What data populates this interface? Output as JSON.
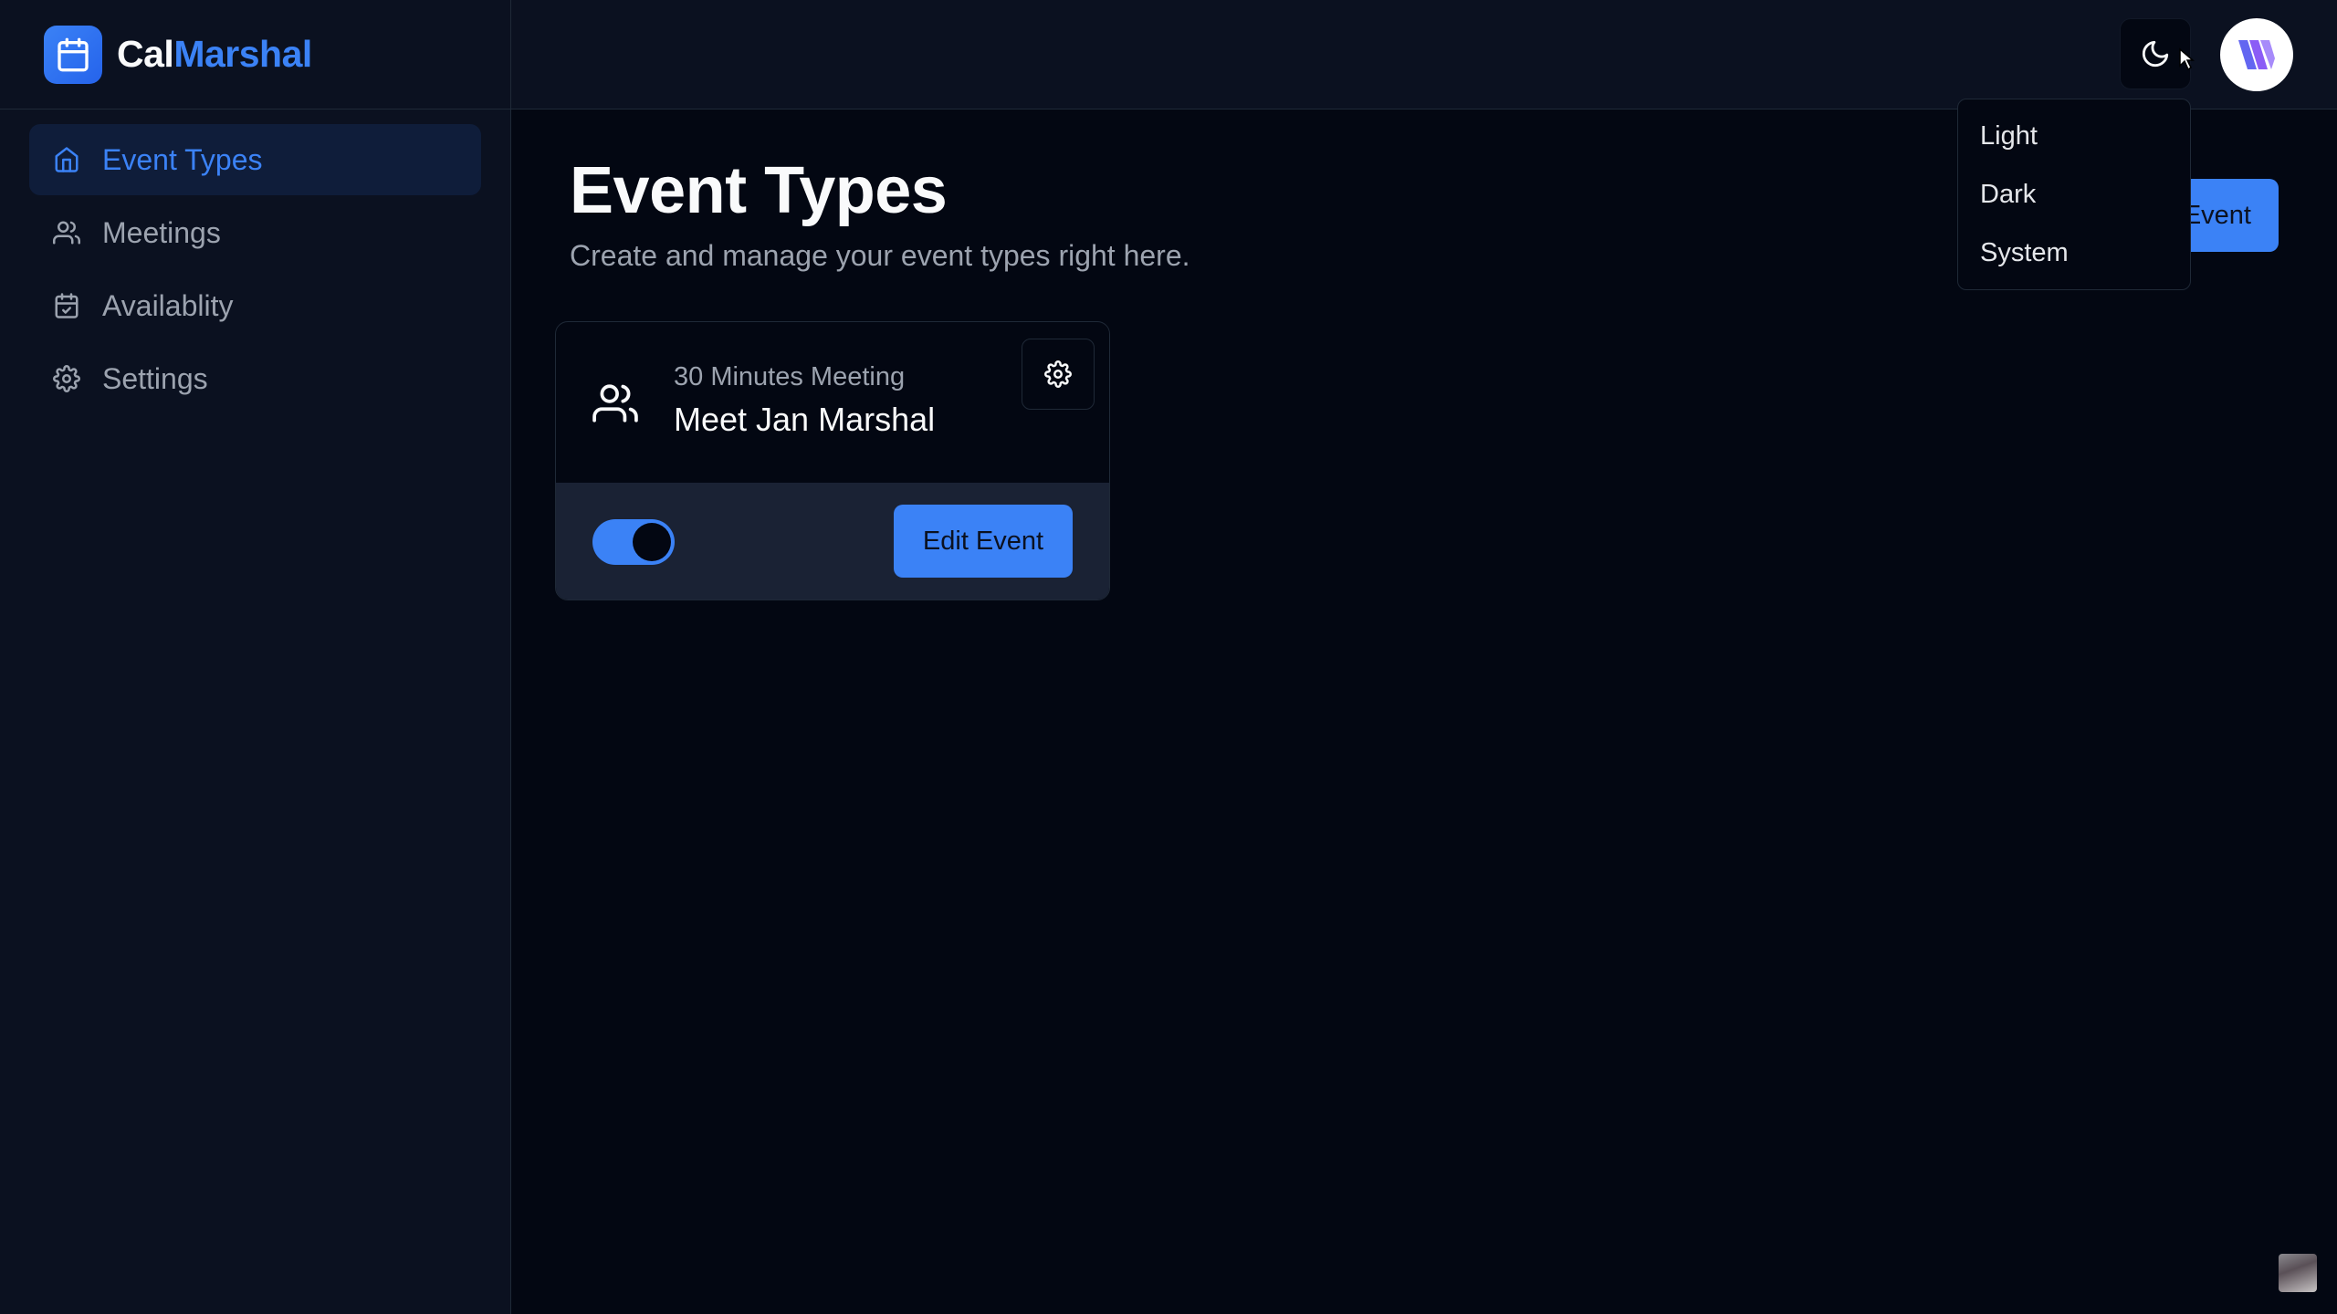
{
  "brand": {
    "name_part1": "Cal",
    "name_part2": "Marshal",
    "logo_icon": "calendar-icon",
    "accent_color": "#3b82f6"
  },
  "sidebar": {
    "items": [
      {
        "label": "Event Types",
        "icon": "home-icon",
        "active": true
      },
      {
        "label": "Meetings",
        "icon": "users-icon",
        "active": false
      },
      {
        "label": "Availablity",
        "icon": "calendar-check-icon",
        "active": false
      },
      {
        "label": "Settings",
        "icon": "gear-icon",
        "active": false
      }
    ]
  },
  "header": {
    "theme_icon": "moon-icon",
    "avatar_icon": "avatar-logo-icon"
  },
  "theme_menu": {
    "items": [
      "Light",
      "Dark",
      "System"
    ]
  },
  "main": {
    "title": "Event Types",
    "subtitle": "Create and manage your event types right here.",
    "create_button_label": "Event"
  },
  "event_card": {
    "duration": "30 Minutes Meeting",
    "name": "Meet Jan Marshal",
    "icon": "users-icon",
    "settings_icon": "gear-icon",
    "enabled": true,
    "edit_label": "Edit Event"
  }
}
